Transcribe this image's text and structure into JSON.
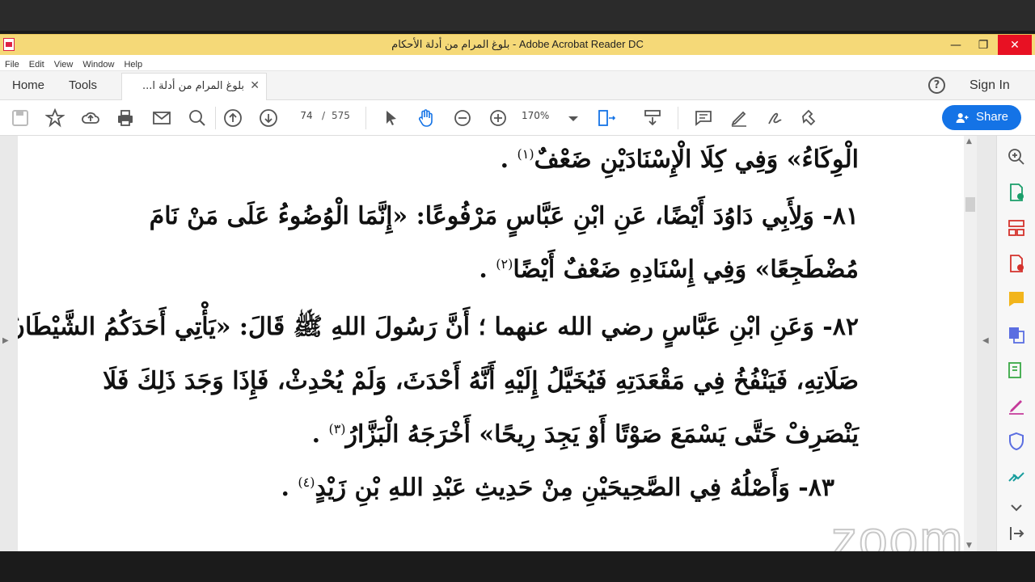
{
  "window": {
    "title": "بلوغ المرام من أدلة الأحكام - Adobe Acrobat Reader DC",
    "controls": {
      "minimize": "—",
      "maximize": "❐",
      "close": "✕"
    }
  },
  "menu": [
    "File",
    "Edit",
    "View",
    "Window",
    "Help"
  ],
  "tabs": {
    "home": "Home",
    "tools": "Tools",
    "document": "بلوغ المرام من أدلة ا...",
    "close": "✕"
  },
  "account": {
    "help": "?",
    "sign_in": "Sign In"
  },
  "toolbar": {
    "current_page": "74",
    "page_separator": "/",
    "total_pages": "575",
    "zoom": "170%",
    "share": "Share",
    "icons": [
      "save-icon",
      "star-icon",
      "upload-icon",
      "print-icon",
      "mail-icon",
      "search-icon",
      "page-up-icon",
      "page-down-icon",
      "select-icon",
      "hand-icon",
      "zoom-out-icon",
      "zoom-in-icon",
      "fit-icon",
      "scroll-icon",
      "comment-icon",
      "highlight-icon",
      "sign-icon",
      "tools-icon"
    ]
  },
  "document_lines": [
    {
      "text": "الْوِكَاءُ» وَفِي كِلَا الْإِسْنَادَيْنِ ضَعْفٌ",
      "fn": "(١)",
      "end": " ."
    },
    {
      "text": "٨١- وَلِأَبِي دَاوُدَ أَيْضًا، عَنِ ابْنِ عَبَّاسٍ مَرْفُوعًا: «إِنَّمَا الْوُضُوءُ عَلَى مَنْ نَامَ",
      "fn": "",
      "end": ""
    },
    {
      "text": "مُضْطَجِعًا» وَفِي إِسْنَادِهِ ضَعْفٌ أَيْضًا",
      "fn": "(٢)",
      "end": " ."
    },
    {
      "text": "٨٢- وَعَنِ ابْنِ عَبَّاسٍ رضي الله عنهما ؛ أَنَّ رَسُولَ اللهِ ﷺ قَالَ: «يَأْتِي أَحَدَكُمُ الشَّيْطَانُ فِي",
      "fn": "",
      "end": ""
    },
    {
      "text": "صَلَاتِهِ، فَيَنْفُخُ فِي مَقْعَدَتِهِ فَيُخَيَّلُ إِلَيْهِ أَنَّهُ أَحْدَثَ، وَلَمْ يُحْدِثْ، فَإِذَا وَجَدَ ذَلِكَ فَلَا",
      "fn": "",
      "end": ""
    },
    {
      "text": "يَنْصَرِفْ حَتَّى يَسْمَعَ صَوْتًا أَوْ يَجِدَ رِيحًا» أَخْرَجَهُ الْبَزَّارُ",
      "fn": "(٣)",
      "end": " ."
    },
    {
      "text": "٨٣- وَأَصْلُهُ فِي الصَّحِيحَيْنِ مِنْ حَدِيثِ عَبْدِ اللهِ بْنِ زَيْدٍ",
      "fn": "(٤)",
      "end": " ."
    }
  ],
  "watermark": "zoom",
  "colors": {
    "titlebar": "#f5d978",
    "accent": "#1473e6",
    "close": "#e81123"
  }
}
